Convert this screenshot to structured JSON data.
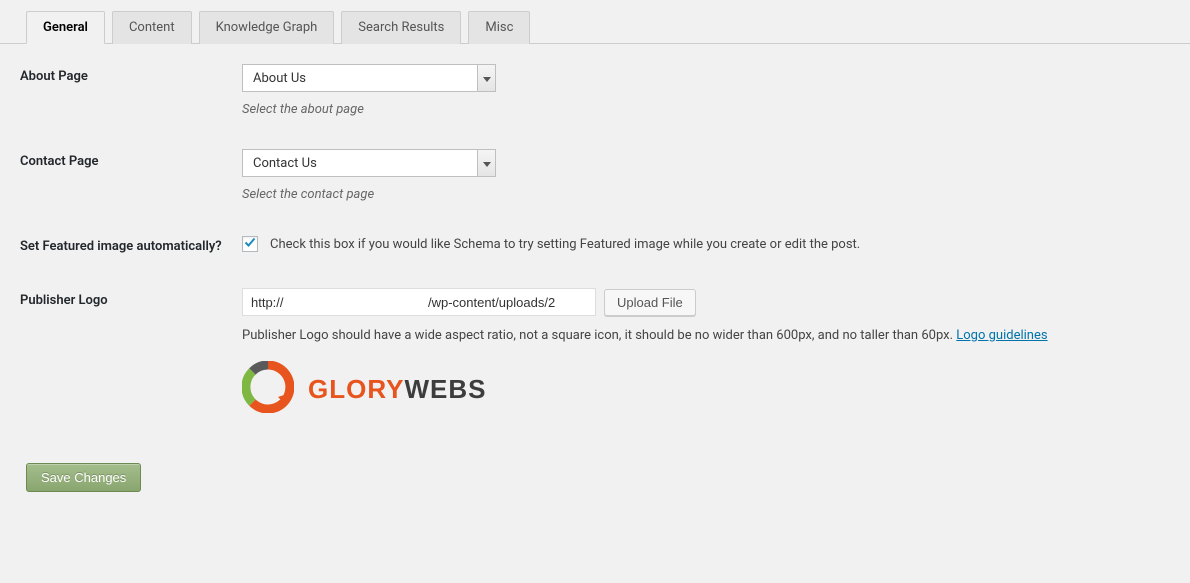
{
  "tabs": [
    {
      "label": "General",
      "active": true
    },
    {
      "label": "Content",
      "active": false
    },
    {
      "label": "Knowledge Graph",
      "active": false
    },
    {
      "label": "Search Results",
      "active": false
    },
    {
      "label": "Misc",
      "active": false
    }
  ],
  "aboutPage": {
    "label": "About Page",
    "value": "About Us",
    "hint": "Select the about page"
  },
  "contactPage": {
    "label": "Contact Page",
    "value": "Contact Us",
    "hint": "Select the contact page"
  },
  "featuredImage": {
    "label": "Set Featured image automatically?",
    "checked": true,
    "description": "Check this box if you would like Schema to try setting Featured image while you create or edit the post."
  },
  "publisherLogo": {
    "label": "Publisher Logo",
    "urlValue": "http://                                        /wp-content/uploads/2",
    "uploadButton": "Upload File",
    "description": "Publisher Logo should have a wide aspect ratio, not a square icon, it should be no wider than 600px, and no taller than 60px. ",
    "guidelinesLink": "Logo guidelines",
    "logoText1": "GLORY",
    "logoText2": "WEBS"
  },
  "saveButton": "Save Changes"
}
